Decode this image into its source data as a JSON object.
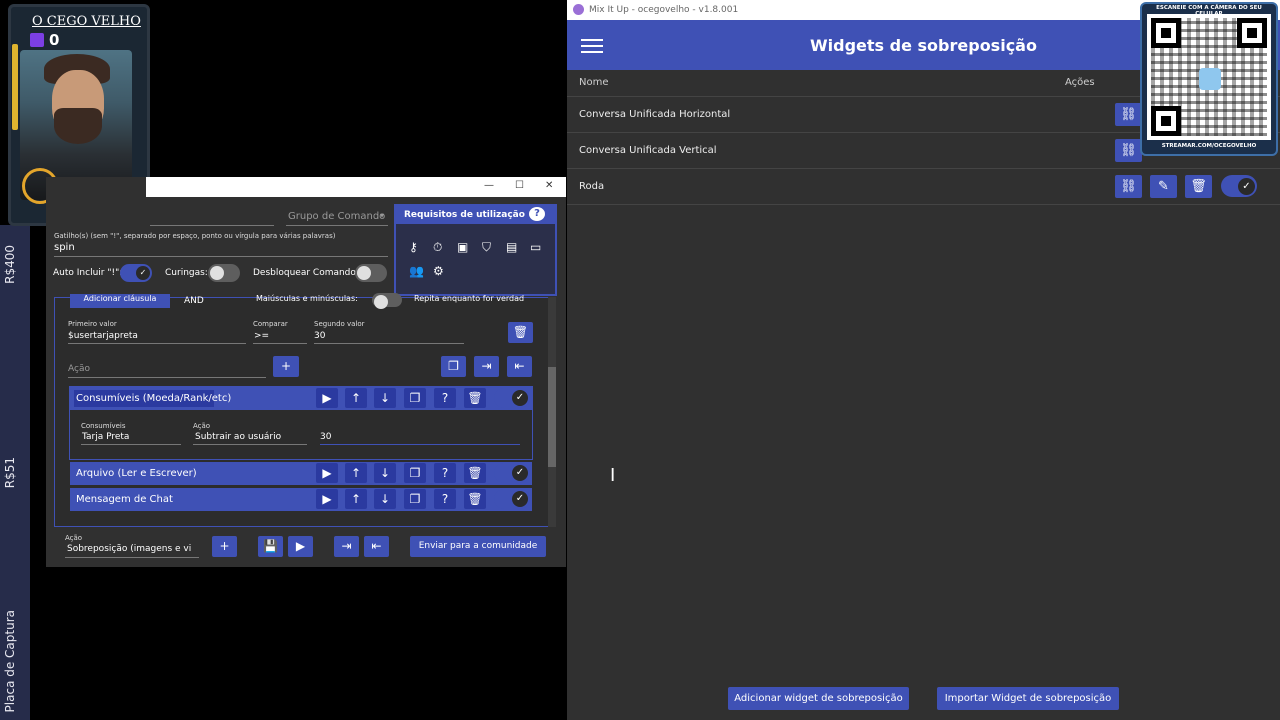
{
  "stream": {
    "left_labels": [
      "R$400",
      "R$51",
      "Placa de Captura"
    ],
    "cam_name": "O CEGO VELHO",
    "cam_count": "0"
  },
  "miu": {
    "window_title": "Mix It Up - ocegovelho - v1.8.001",
    "page_title": "Widgets de sobreposição",
    "col_name": "Nome",
    "col_actions": "Ações",
    "widgets": [
      {
        "name": "Conversa Unificada Horizontal"
      },
      {
        "name": "Conversa Unificada Vertical"
      },
      {
        "name": "Roda"
      }
    ],
    "add_button": "Adicionar widget de sobreposição",
    "import_button": "Importar Widget de sobreposição",
    "accent": "#3f51b5"
  },
  "qr": {
    "top_text": "ESCANEIE COM A CÂMERA DO SEU CELULAR",
    "bottom_text": "STREAMAR.COM/OCEGOVELHO"
  },
  "cmd": {
    "command_group_placeholder": "Grupo de Comando",
    "triggers_label": "Gatilho(s) (sem \"!\", separado por espaço, ponto ou vírgula para várias palavras)",
    "triggers_value": "spin",
    "auto_include_label": "Auto Incluir \"!\":",
    "wildcards_label": "Curingas:",
    "unlock_label": "Desbloquear Comando:",
    "requirements_title": "Requisitos de utilização",
    "clause_add_button": "Adicionar cláusula",
    "clause_operator": "AND",
    "case_label": "Maiúsculas e minúsculas:",
    "repeat_label": "Repita enquanto for verdad",
    "first_value_label": "Primeiro valor",
    "first_value": "$usertarjapreta",
    "compare_label": "Comparar",
    "compare_value": ">=",
    "second_value_label": "Segundo valor",
    "second_value": "30",
    "action_placeholder": "Ação",
    "actions": [
      {
        "label": "Consumíveis (Moeda/Rank/etc)"
      },
      {
        "label": "Arquivo (Ler e Escrever)"
      },
      {
        "label": "Mensagem de Chat"
      }
    ],
    "consumable_label": "Consumíveis",
    "consumable_value": "Tarja Preta",
    "action_label": "Ação",
    "action_value": "Subtrair ao usuário",
    "amount_value": "30",
    "bottom_action_label": "Ação",
    "bottom_action_value": "Sobreposição (imagens e vi",
    "send_community_button": "Enviar para a comunidade"
  }
}
